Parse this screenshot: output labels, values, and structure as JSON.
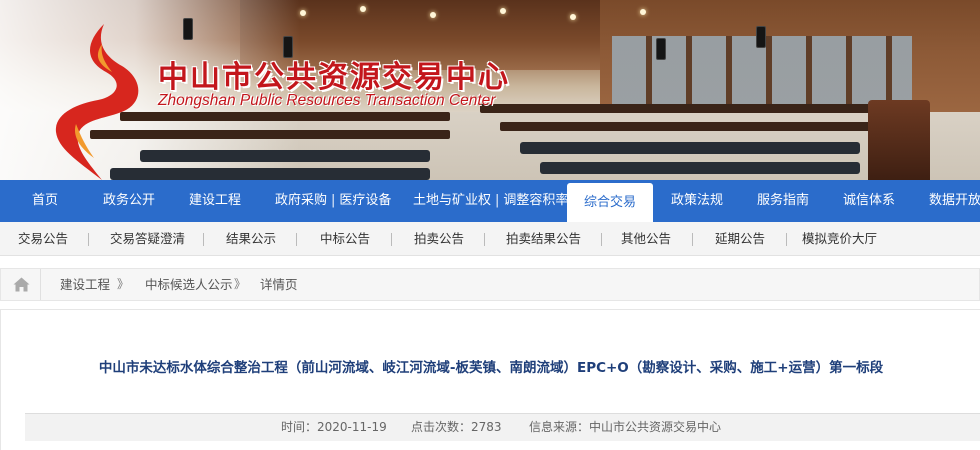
{
  "header": {
    "brand_cn": "中山市公共资源交易中心",
    "brand_en": "Zhongshan Public Resources Transaction Center",
    "brand_color": "#c3161c"
  },
  "main_nav": {
    "bg_color": "#2b6ccb",
    "items": [
      {
        "label": "首页"
      },
      {
        "label": "政务公开"
      },
      {
        "label": "建设工程"
      },
      {
        "label": "政府采购",
        "label2": "医疗设备"
      },
      {
        "label": "土地与矿业权",
        "label2": "调整容积率"
      },
      {
        "label": "综合交易",
        "active": true
      },
      {
        "label": "政策法规"
      },
      {
        "label": "服务指南"
      },
      {
        "label": "诚信体系"
      },
      {
        "label": "数据开放"
      }
    ],
    "separator": "|"
  },
  "sub_nav": {
    "items": [
      {
        "label": "交易公告"
      },
      {
        "label": "交易答疑澄清"
      },
      {
        "label": "结果公示"
      },
      {
        "label": "中标公告"
      },
      {
        "label": "拍卖公告"
      },
      {
        "label": "拍卖结果公告"
      },
      {
        "label": "其他公告"
      },
      {
        "label": "延期公告"
      },
      {
        "label": "模拟竞价大厅"
      }
    ]
  },
  "breadcrumb": {
    "home_icon": "home-icon",
    "items": [
      "建设工程",
      "中标候选人公示",
      "详情页"
    ],
    "separator": "》"
  },
  "article": {
    "title": "中山市未达标水体综合整治工程（前山河流域、岐江河流域-板芙镇、南朗流域）EPC+O（勘察设计、采购、施工+运营）第一标段",
    "time_label": "时间：2020-11-19",
    "clicks_label": "点击次数：2783",
    "source_label": "信息来源：中山市公共资源交易中心"
  }
}
